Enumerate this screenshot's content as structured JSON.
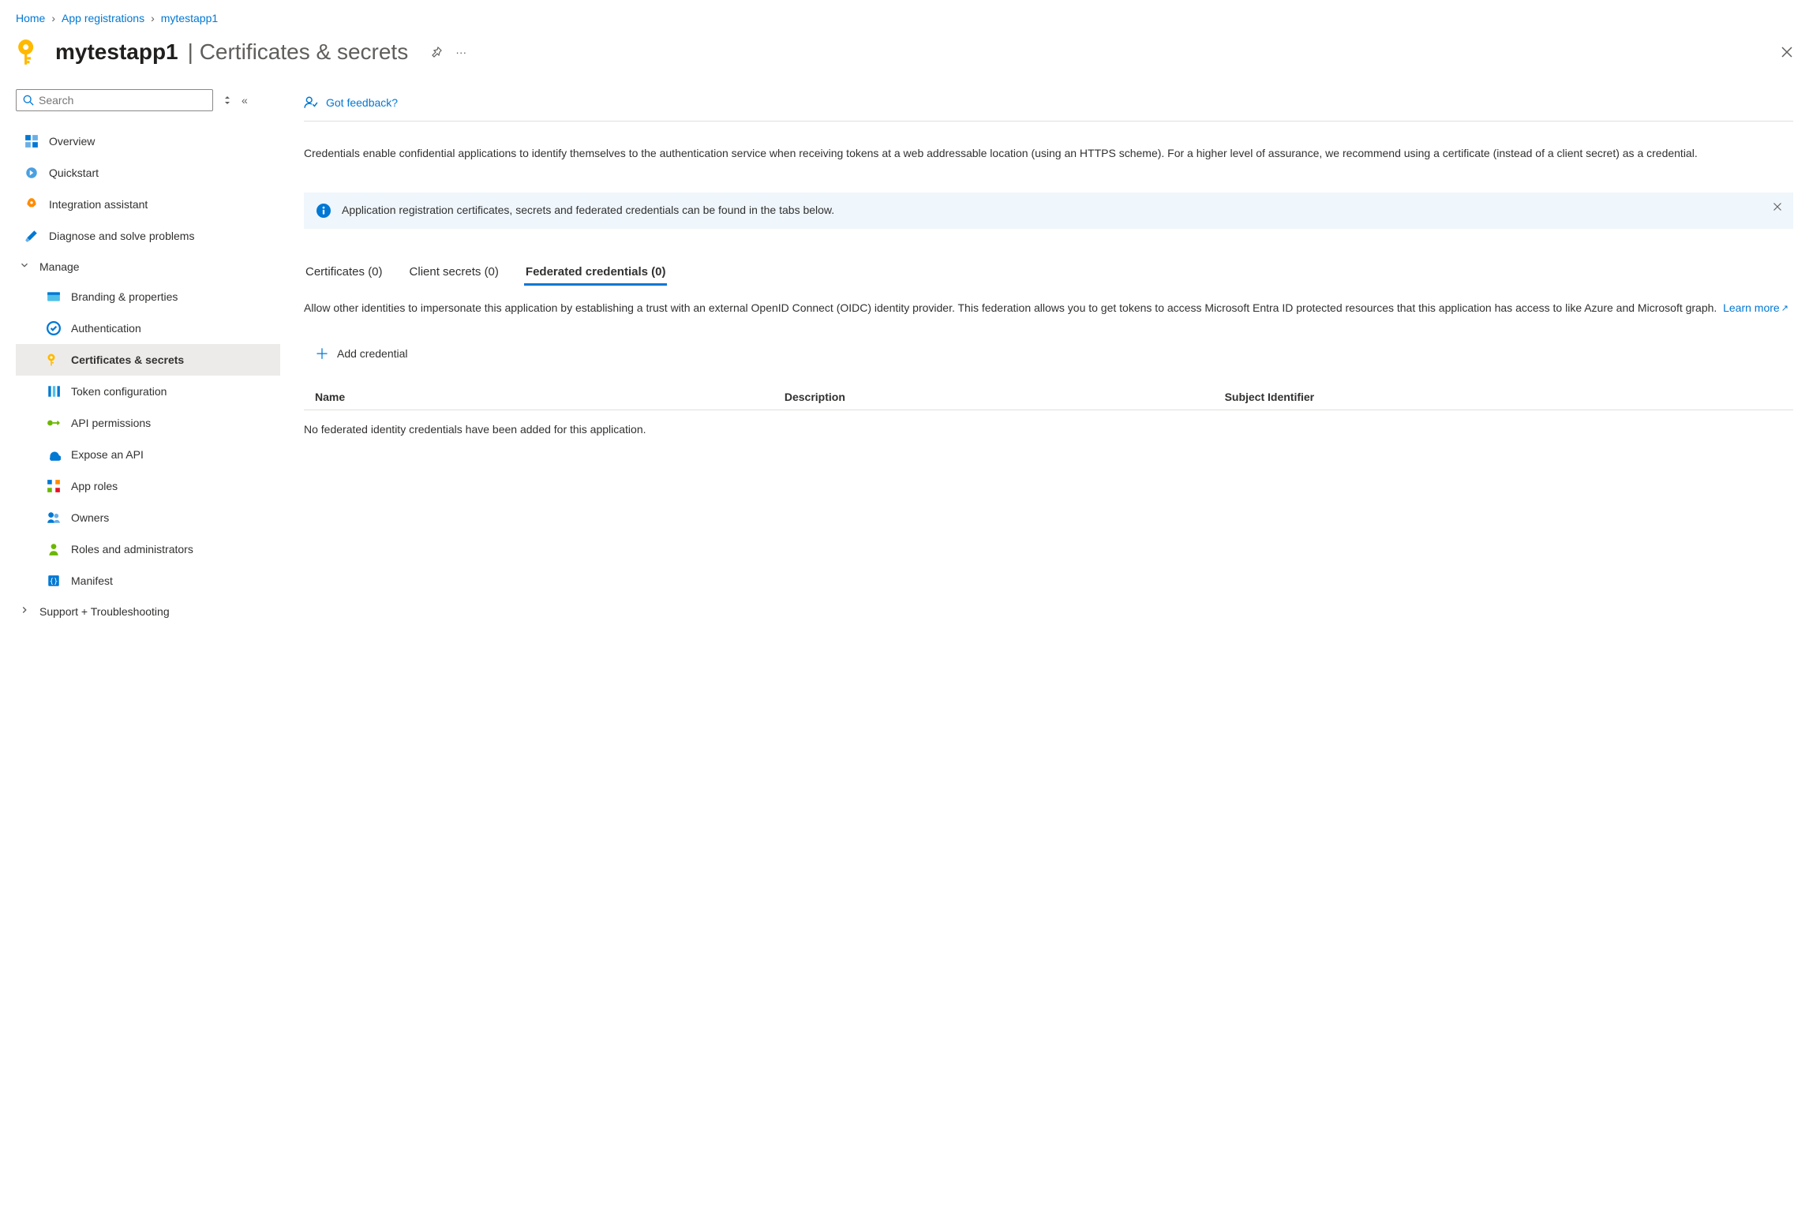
{
  "breadcrumb": {
    "items": [
      "Home",
      "App registrations",
      "mytestapp1"
    ]
  },
  "header": {
    "app_name": "mytestapp1",
    "page_title": "Certificates & secrets"
  },
  "sidebar": {
    "search_placeholder": "Search",
    "items": [
      {
        "label": "Overview"
      },
      {
        "label": "Quickstart"
      },
      {
        "label": "Integration assistant"
      },
      {
        "label": "Diagnose and solve problems"
      }
    ],
    "manage_label": "Manage",
    "manage_items": [
      {
        "label": "Branding & properties"
      },
      {
        "label": "Authentication"
      },
      {
        "label": "Certificates & secrets"
      },
      {
        "label": "Token configuration"
      },
      {
        "label": "API permissions"
      },
      {
        "label": "Expose an API"
      },
      {
        "label": "App roles"
      },
      {
        "label": "Owners"
      },
      {
        "label": "Roles and administrators"
      },
      {
        "label": "Manifest"
      }
    ],
    "support_label": "Support + Troubleshooting"
  },
  "feedback_label": "Got feedback?",
  "intro_text": "Credentials enable confidential applications to identify themselves to the authentication service when receiving tokens at a web addressable location (using an HTTPS scheme). For a higher level of assurance, we recommend using a certificate (instead of a client secret) as a credential.",
  "banner_text": "Application registration certificates, secrets and federated credentials can be found in the tabs below.",
  "tabs": [
    {
      "label": "Certificates (0)"
    },
    {
      "label": "Client secrets (0)"
    },
    {
      "label": "Federated credentials (0)"
    }
  ],
  "tab_description": "Allow other identities to impersonate this application by establishing a trust with an external OpenID Connect (OIDC) identity provider. This federation allows you to get tokens to access Microsoft Entra ID protected resources that this application has access to like Azure and Microsoft graph.",
  "learn_more": "Learn more",
  "add_credential_label": "Add credential",
  "table_headers": {
    "name": "Name",
    "description": "Description",
    "subject": "Subject Identifier"
  },
  "empty_message": "No federated identity credentials have been added for this application."
}
